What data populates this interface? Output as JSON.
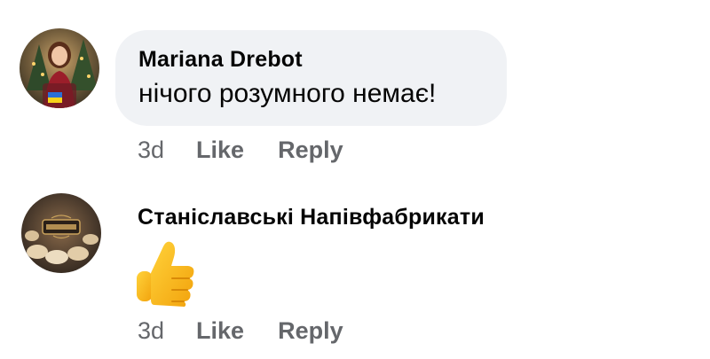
{
  "comments": [
    {
      "author": "Mariana  Drebot",
      "text": "нічого розумного немає!",
      "time": "3d",
      "like_label": "Like",
      "reply_label": "Reply"
    },
    {
      "author": "Станіславські Напівфабрикати",
      "emoji": "thumbs-up-icon",
      "time": "3d",
      "like_label": "Like",
      "reply_label": "Reply"
    }
  ],
  "colors": {
    "bubble": "#f0f2f5",
    "text": "#050505",
    "meta": "#65676b"
  }
}
